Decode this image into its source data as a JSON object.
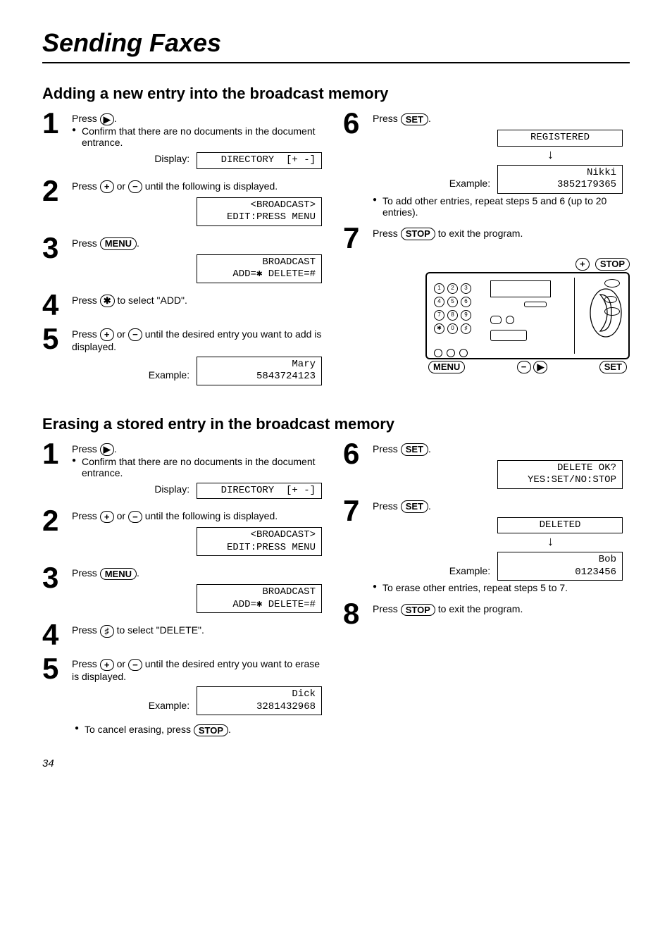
{
  "title": "Sending Faxes",
  "page_number": "34",
  "buttons": {
    "set": "SET",
    "menu": "MENU",
    "stop": "STOP",
    "plus": "+",
    "minus": "−",
    "play": "▶",
    "star": "✱",
    "hash": "♯"
  },
  "labels": {
    "display": "Display:",
    "example": "Example:"
  },
  "keypad": [
    [
      "1",
      "2",
      "3"
    ],
    [
      "4",
      "5",
      "6"
    ],
    [
      "7",
      "8",
      "9"
    ],
    [
      "✱",
      "0",
      "♯"
    ]
  ],
  "add_section": {
    "heading": "Adding a new entry into the broadcast memory",
    "step1": {
      "text_a": "Press ",
      "text_b": ".",
      "bullet": "Confirm that there are no documents in the document entrance.",
      "lcd": "DIRECTORY  [+ -]"
    },
    "step2": {
      "text_a": "Press ",
      "text_mid": " or ",
      "text_b": " until the following is displayed.",
      "lcd": "<BROADCAST>\nEDIT:PRESS MENU"
    },
    "step3": {
      "text_a": "Press ",
      "text_b": ".",
      "lcd": "BROADCAST\nADD=✱ DELETE=#"
    },
    "step4": {
      "text_a": "Press ",
      "text_b": " to select \"ADD\"."
    },
    "step5": {
      "text_a": "Press ",
      "text_mid": " or ",
      "text_b": " until the desired entry you want to add is displayed.",
      "lcd": "Mary\n5843724123"
    },
    "step6": {
      "text_a": "Press ",
      "text_b": ".",
      "lcd_reg": "REGISTERED",
      "lcd_ex": "Nikki\n3852179365",
      "bullet": "To add other entries, repeat steps 5 and 6 (up to 20 entries)."
    },
    "step7": {
      "text_a": "Press ",
      "text_b": " to exit the program."
    }
  },
  "erase_section": {
    "heading": "Erasing a stored entry in the broadcast memory",
    "step1": {
      "text_a": "Press ",
      "text_b": ".",
      "bullet": "Confirm that there are no documents in the document entrance.",
      "lcd": "DIRECTORY  [+ -]"
    },
    "step2": {
      "text_a": "Press ",
      "text_mid": " or ",
      "text_b": " until the following is displayed.",
      "lcd": "<BROADCAST>\nEDIT:PRESS MENU"
    },
    "step3": {
      "text_a": "Press ",
      "text_b": ".",
      "lcd": "BROADCAST\nADD=✱ DELETE=#"
    },
    "step4": {
      "text_a": "Press ",
      "text_b": " to select \"DELETE\"."
    },
    "step5": {
      "text_a": "Press ",
      "text_mid": " or ",
      "text_b": " until the desired entry you want to erase is displayed.",
      "lcd": "Dick\n3281432968",
      "cancel_a": "To cancel erasing, press ",
      "cancel_b": "."
    },
    "step6": {
      "text_a": "Press ",
      "text_b": ".",
      "lcd": "DELETE OK?\nYES:SET/NO:STOP"
    },
    "step7": {
      "text_a": "Press ",
      "text_b": ".",
      "lcd_del": "DELETED",
      "lcd_ex": "Bob\n0123456",
      "bullet": "To erase other entries, repeat steps 5 to 7."
    },
    "step8": {
      "text_a": "Press ",
      "text_b": " to exit the program."
    }
  }
}
